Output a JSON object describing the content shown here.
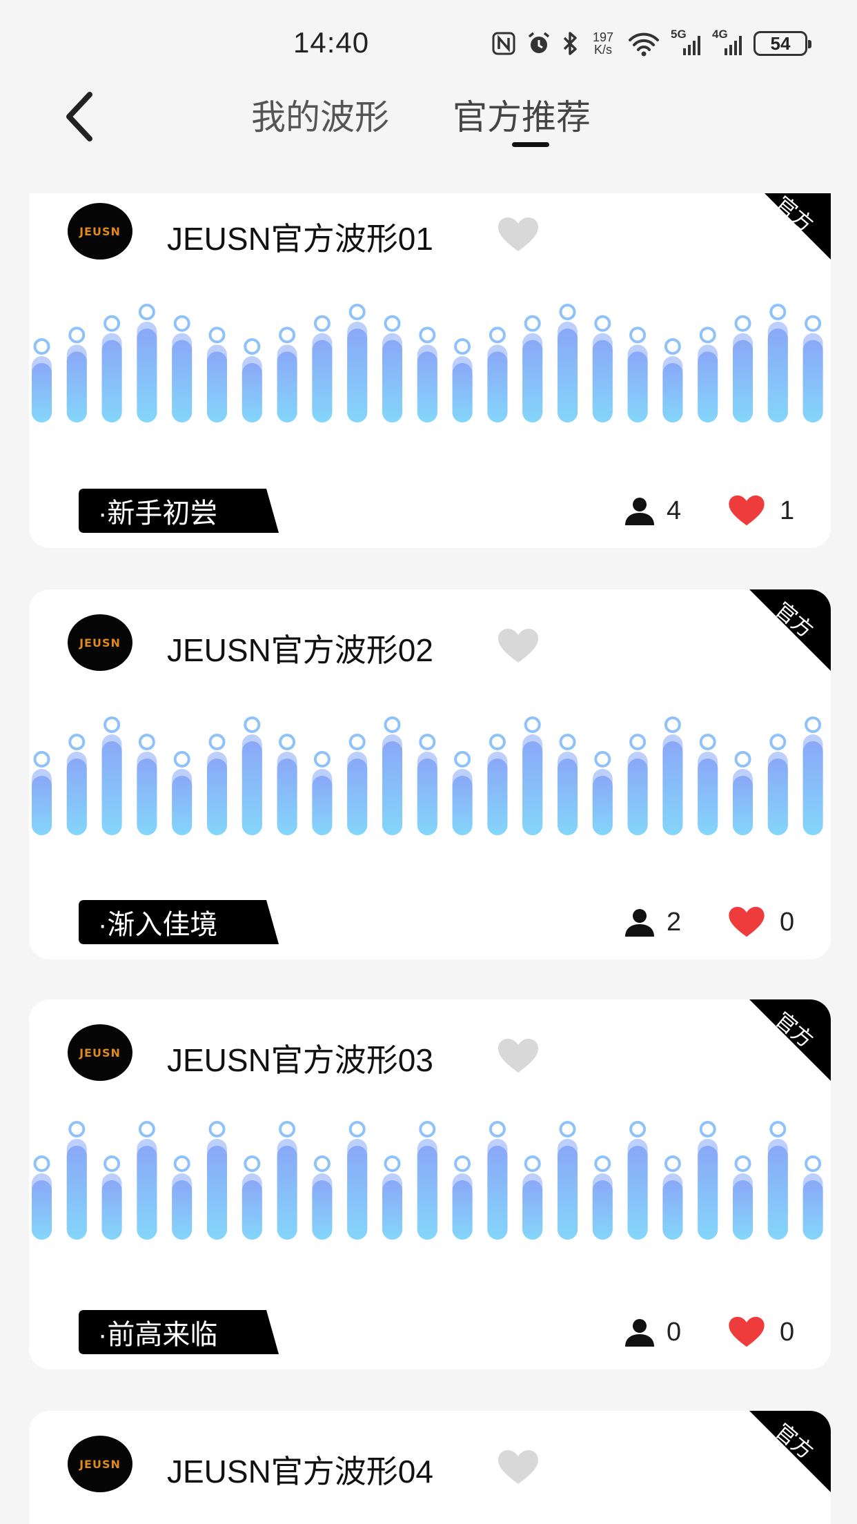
{
  "status_bar": {
    "time": "14:40",
    "net_speed_value": "197",
    "net_speed_unit": "K/s",
    "signal_5g": "5G",
    "signal_4g": "4G",
    "battery": "54"
  },
  "header": {
    "tabs": [
      {
        "label": "我的波形",
        "active": false
      },
      {
        "label": "官方推荐",
        "active": true
      }
    ]
  },
  "cards": [
    {
      "title": "JEUSN官方波形01",
      "tag": "·新手初尝",
      "users": "4",
      "likes": "1",
      "badge": "官方",
      "avatar_text": "JEUSN",
      "levels": [
        2,
        3,
        4,
        5,
        4,
        3,
        2,
        3,
        4,
        5,
        4,
        3,
        2,
        3,
        4,
        5,
        4,
        3,
        2,
        3,
        4,
        5,
        4
      ]
    },
    {
      "title": "JEUSN官方波形02",
      "tag": "·渐入佳境",
      "users": "2",
      "likes": "0",
      "badge": "官方",
      "avatar_text": "JEUSN",
      "levels": [
        1,
        2,
        3,
        2,
        1,
        2,
        3,
        2,
        1,
        2,
        3,
        2,
        1,
        2,
        3,
        2,
        1,
        2,
        3,
        2,
        1,
        2,
        3
      ]
    },
    {
      "title": "JEUSN官方波形03",
      "tag": "·前高来临",
      "users": "0",
      "likes": "0",
      "badge": "官方",
      "avatar_text": "JEUSN",
      "levels": [
        1,
        3,
        1,
        3,
        1,
        3,
        1,
        3,
        1,
        3,
        1,
        3,
        1,
        3,
        1,
        3,
        1,
        3,
        1,
        3,
        1,
        3,
        1
      ]
    },
    {
      "title": "JEUSN官方波形04",
      "badge": "官方",
      "avatar_text": "JEUSN"
    }
  ],
  "colors": {
    "bar_top": "#8aa8f7",
    "bar_bottom": "#84d6fb",
    "like_red": "#ee3b3b",
    "fav_grey": "#d8d8d8"
  }
}
